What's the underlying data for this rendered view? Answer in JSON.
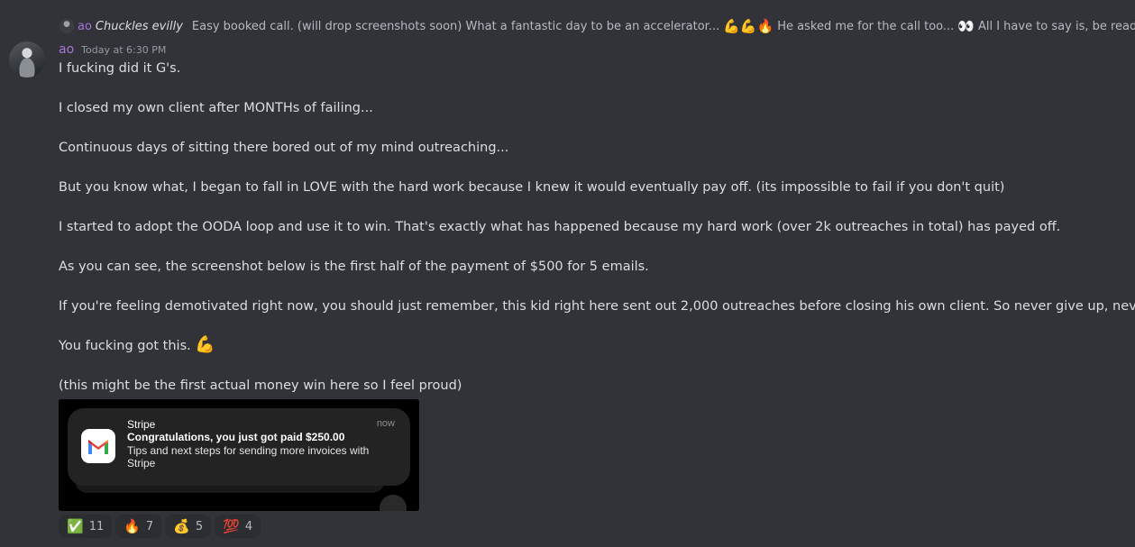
{
  "reply": {
    "author": "ao",
    "nickname": "Chuckles evilly",
    "text_1": "Easy booked call. (will drop screenshots soon)  What a fantastic day to be an accelerator...",
    "emojis_1": "💪💪🔥",
    "text_2": "He asked me for the call too...",
    "emojis_2": "👀",
    "text_3": "All I have to say is, be ready to pay me that"
  },
  "message": {
    "author": "ao",
    "timestamp": "Today at 6:30 PM",
    "lines": [
      "I fucking did it G's.",
      "I closed my own client after MONTHs of failing...",
      "Continuous days of sitting there bored out of my mind outreaching...",
      "But you know what, I began to fall in LOVE with the hard work because I knew it would eventually pay off. (its impossible to fail if you don't quit)",
      "I started to adopt the OODA loop and use it to win. That's exactly what has happened because my hard work (over 2k outreaches in total) has payed off.",
      "As you can see, the screenshot below is the first half of the payment of $500 for 5 emails.",
      "If you're feeling demotivated right now, you should just remember, this kid right here sent out 2,000 outreaches before closing his own client. So never give up, never quit.",
      "You fucking got this.",
      "(this might be the first actual money win here so I feel proud)"
    ],
    "flex_emoji": "💪"
  },
  "attachment": {
    "app": "Stripe",
    "time": "now",
    "title": "Congratulations, you just got paid $250.00",
    "text": "Tips and next steps for sending more invoices with Stripe",
    "icon": "gmail-icon"
  },
  "reactions": [
    {
      "emoji": "✅",
      "count": "11"
    },
    {
      "emoji": "🔥",
      "count": "7"
    },
    {
      "emoji": "💰",
      "count": "5"
    },
    {
      "emoji": "💯",
      "count": "4"
    }
  ],
  "colors": {
    "background": "#313338",
    "username": "#a874d8",
    "text": "#dbdee1",
    "muted": "#949ba4"
  }
}
